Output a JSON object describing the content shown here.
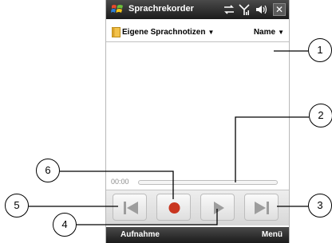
{
  "window": {
    "title": "Sprachrekorder",
    "close_label": "✕"
  },
  "folder_bar": {
    "folder_label": "Eigene Sprachnotizen",
    "sort_label": "Name"
  },
  "playback": {
    "time": "00:00",
    "progress": 0
  },
  "controls": {
    "items": [
      "previous-track",
      "record",
      "play",
      "next-track"
    ]
  },
  "softkeys": {
    "left": "Aufnahme",
    "right": "Menü"
  },
  "callouts": [
    "1",
    "2",
    "3",
    "4",
    "5",
    "6"
  ],
  "colors": {
    "titlebar": "#2e2e2e",
    "record": "#c9351f",
    "control_glyph": "#9d9d9d",
    "progress_border": "#bdbdbd"
  }
}
